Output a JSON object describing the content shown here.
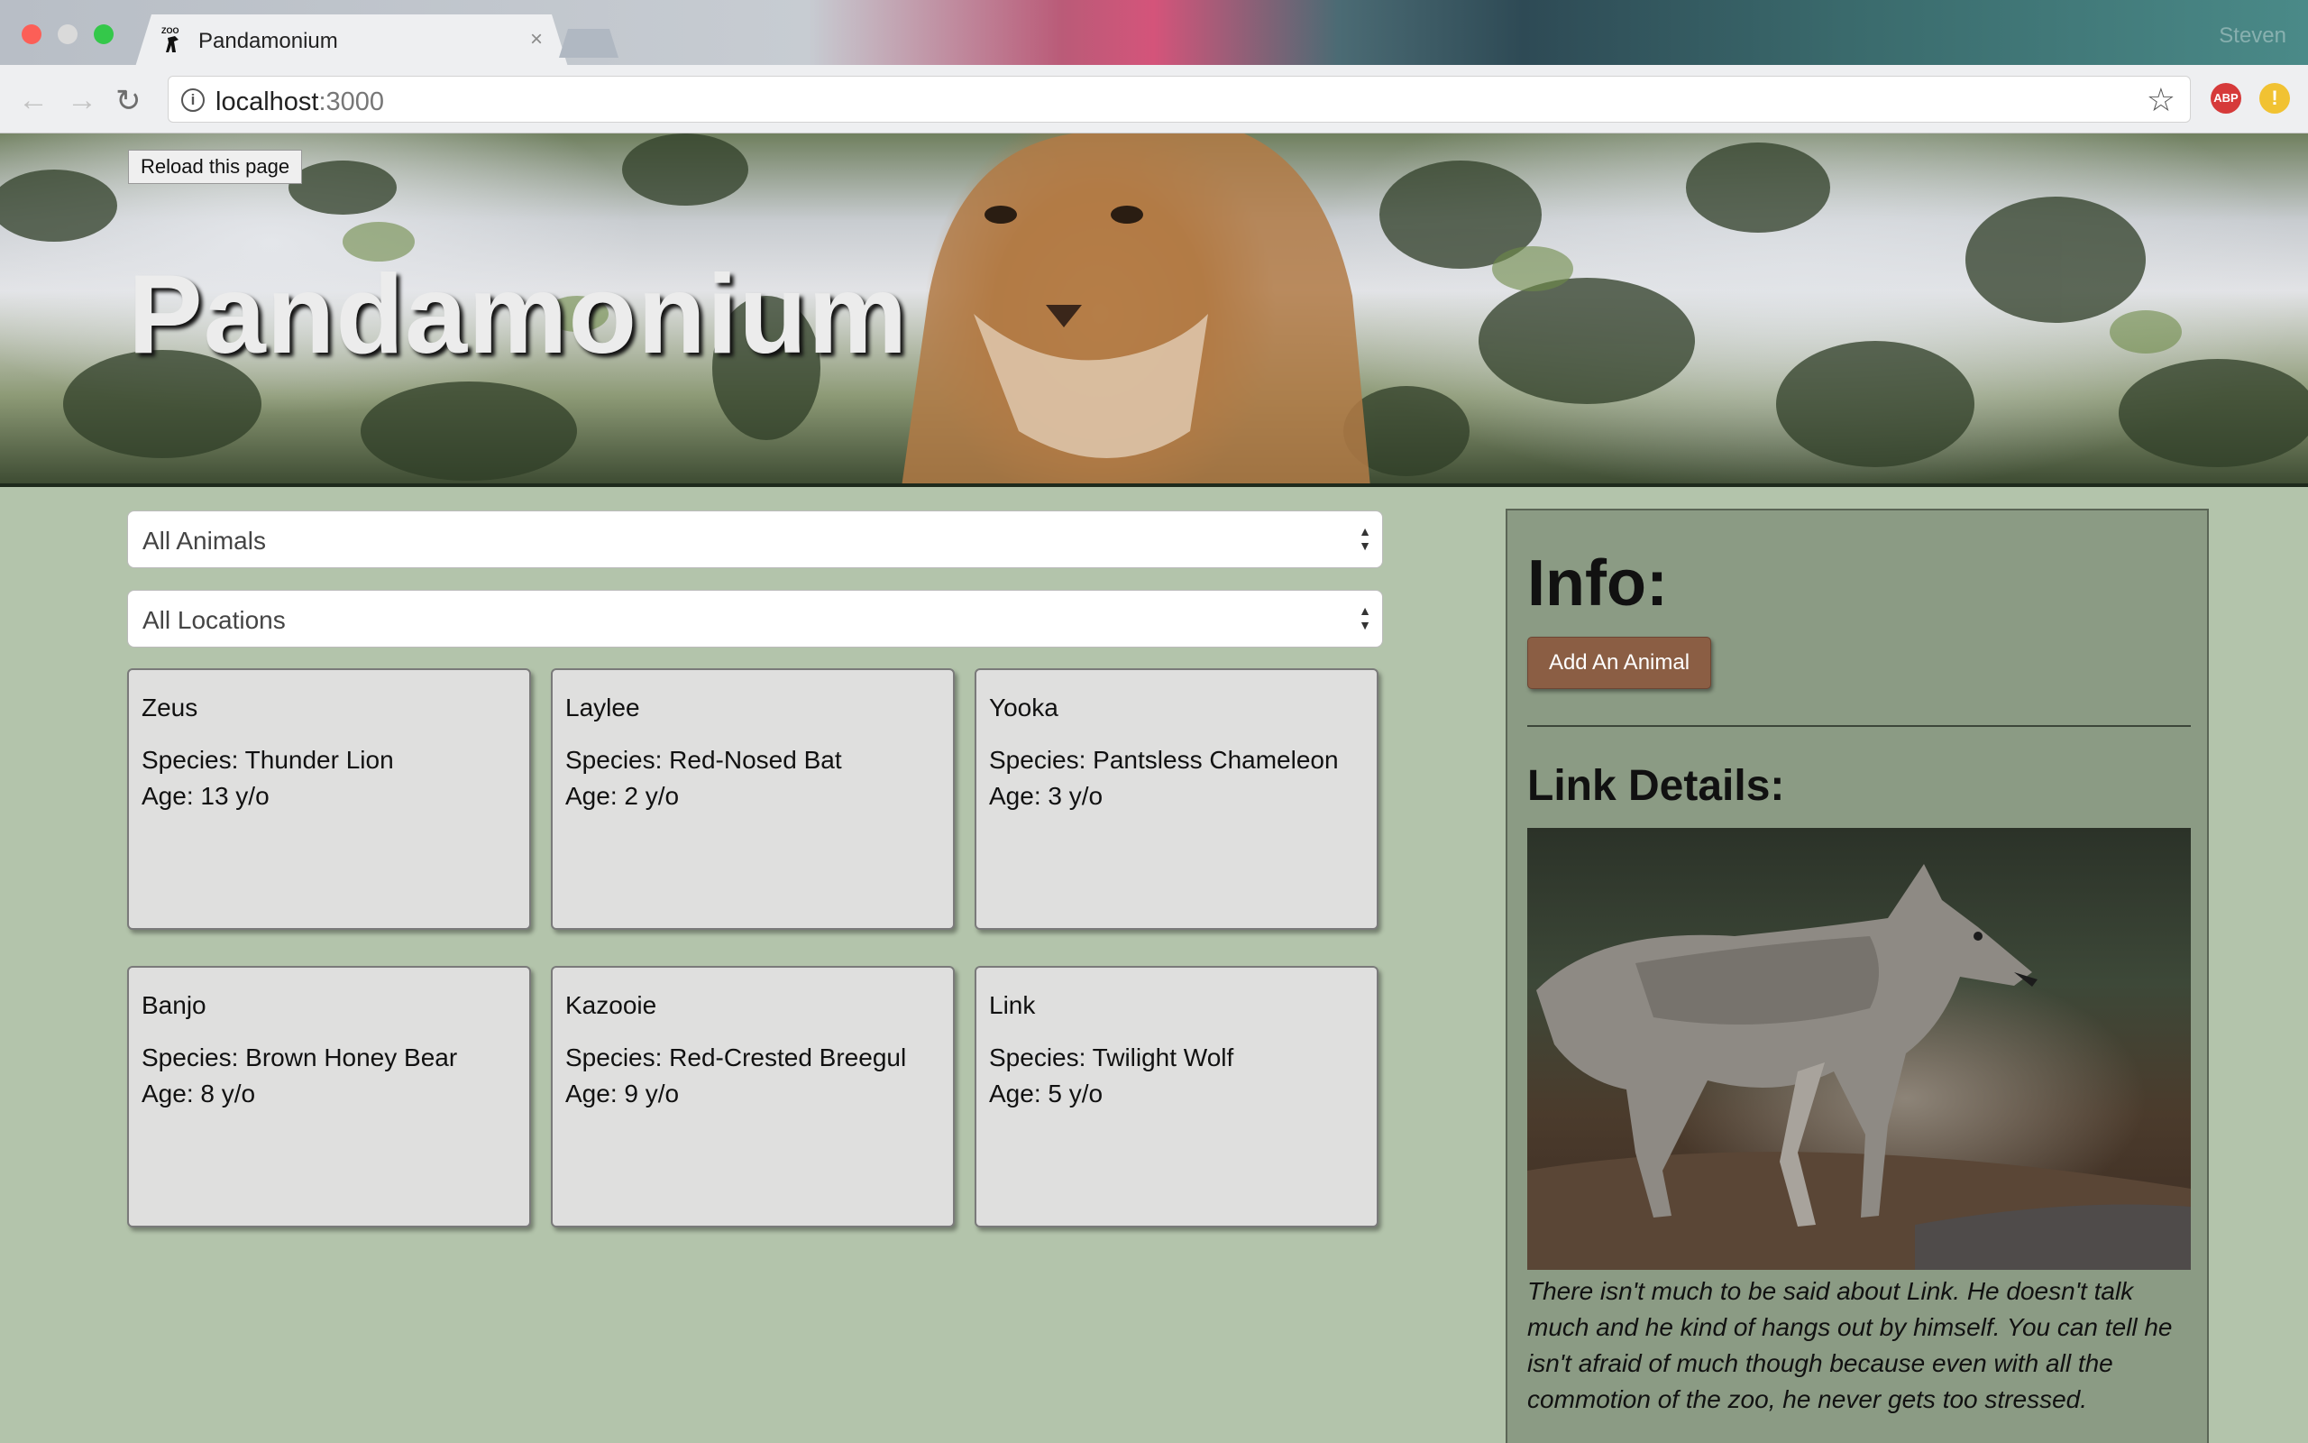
{
  "browser": {
    "tab_title": "Pandamonium",
    "tab_close": "×",
    "profile_name": "Steven",
    "url_host": "localhost",
    "url_port": ":3000",
    "extensions": [
      "ABP",
      "!"
    ],
    "icons": [
      "back-icon",
      "forward-icon",
      "reload-icon",
      "info-icon",
      "star-icon",
      "adblock-icon",
      "extension-warning-icon"
    ]
  },
  "hero": {
    "reload_label": "Reload this page",
    "title": "Pandamonium"
  },
  "filters": {
    "animals": "All Animals",
    "locations": "All Locations"
  },
  "animals": [
    {
      "name": "Zeus",
      "species": "Species: Thunder Lion",
      "age": "Age: 13 y/o"
    },
    {
      "name": "Laylee",
      "species": "Species: Red-Nosed Bat",
      "age": "Age: 2 y/o"
    },
    {
      "name": "Yooka",
      "species": "Species: Pantsless Chameleon",
      "age": "Age: 3 y/o"
    },
    {
      "name": "Banjo",
      "species": "Species: Brown Honey Bear",
      "age": "Age: 8 y/o"
    },
    {
      "name": "Kazooie",
      "species": "Species: Red-Crested Breegul",
      "age": "Age: 9 y/o"
    },
    {
      "name": "Link",
      "species": "Species: Twilight Wolf",
      "age": "Age: 5 y/o"
    }
  ],
  "info": {
    "heading": "Info:",
    "add_button": "Add An Animal",
    "details_heading": "Link Details:",
    "description": "There isn't much to be said about Link. He doesn't talk much and he kind of hangs out by himself. You can tell he isn't afraid of much though because even with all the commotion of the zoo, he never gets too stressed."
  },
  "colors": {
    "page_bg": "#b3c4ab",
    "panel_bg": "#8b9b84",
    "card_bg": "#dfdfde",
    "button_brown": "#8b5e44"
  }
}
